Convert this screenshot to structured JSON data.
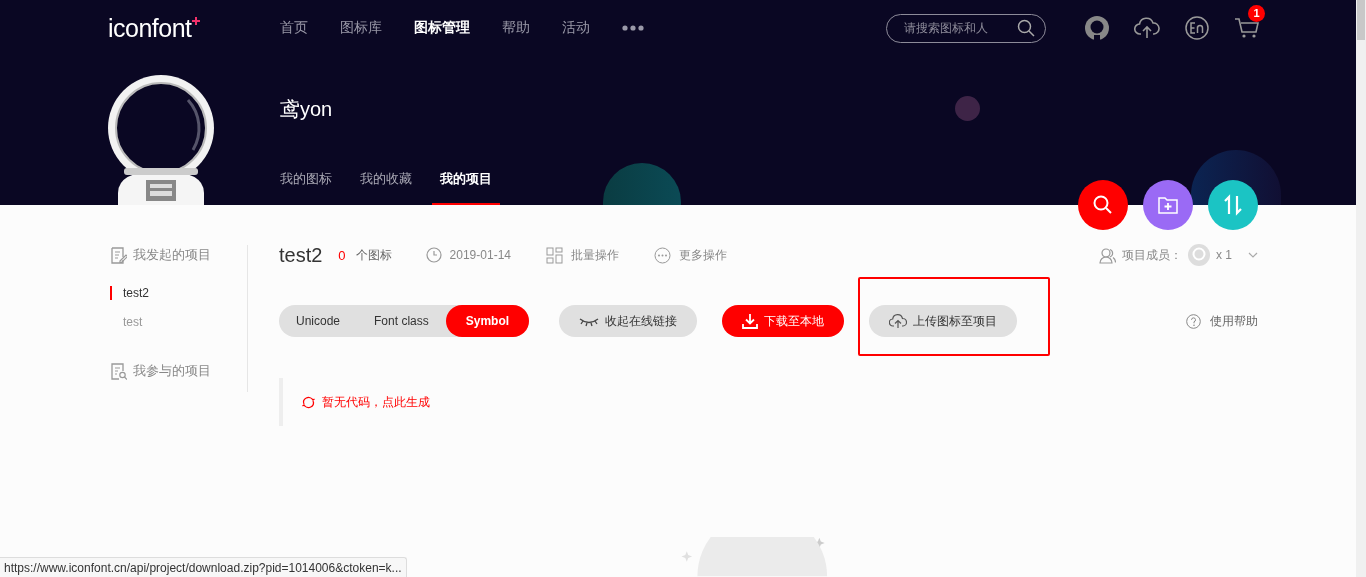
{
  "logo": "iconfont",
  "nav": [
    {
      "label": "首页",
      "selected": false
    },
    {
      "label": "图标库",
      "selected": false
    },
    {
      "label": "图标管理",
      "selected": true
    },
    {
      "label": "帮助",
      "selected": false
    },
    {
      "label": "活动",
      "selected": false
    }
  ],
  "search": {
    "placeholder": "请搜索图标和人"
  },
  "cart_badge": "1",
  "profile": {
    "name": "鸢yon"
  },
  "profile_tabs": [
    {
      "label": "我的图标",
      "selected": false
    },
    {
      "label": "我的收藏",
      "selected": false
    },
    {
      "label": "我的项目",
      "selected": true
    }
  ],
  "sidebar": [
    {
      "title": "我发起的项目",
      "kind": "owned",
      "items": [
        {
          "label": "test2",
          "selected": true
        },
        {
          "label": "test",
          "selected": false
        }
      ]
    },
    {
      "title": "我参与的项目",
      "kind": "joined"
    }
  ],
  "project": {
    "name": "test2",
    "icon_count": "0",
    "icon_count_label": "个图标",
    "date": "2019-01-14",
    "actions": [
      {
        "label": "批量操作",
        "kind": "batch"
      },
      {
        "label": "更多操作",
        "kind": "more"
      }
    ],
    "members_label": "项目成员：",
    "members_count": "x 1"
  },
  "code_tabs": [
    {
      "label": "Unicode",
      "selected": false
    },
    {
      "label": "Font class",
      "selected": false
    },
    {
      "label": "Symbol",
      "selected": true
    }
  ],
  "buttons": [
    {
      "label": "收起在线链接",
      "kind": "toggle",
      "highlighted": false
    },
    {
      "label": "下载至本地",
      "kind": "download",
      "highlighted": false
    },
    {
      "label": "上传图标至项目",
      "kind": "upload",
      "highlighted": true
    }
  ],
  "help": "使用帮助",
  "empty_message": "暂无代码，点此生成",
  "status_url": "https://www.iconfont.cn/api/project/download.zip?pid=1014006&ctoken=k..."
}
